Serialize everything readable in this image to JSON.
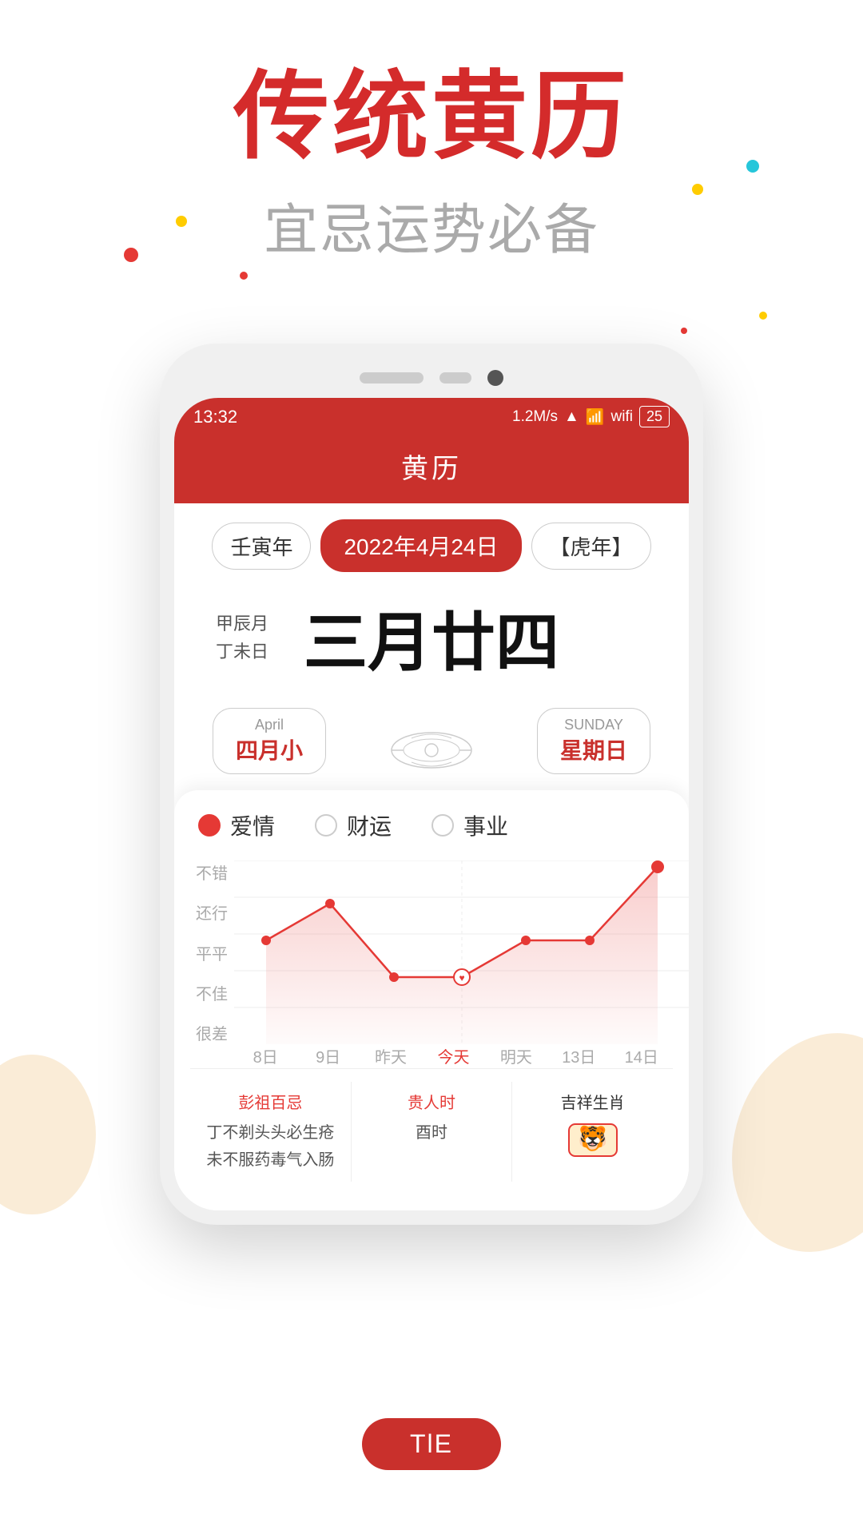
{
  "hero": {
    "title": "传统黄历",
    "subtitle": "宜忌运势必备"
  },
  "status_bar": {
    "time": "13:32",
    "speed": "1.2M/s",
    "battery": "25"
  },
  "app": {
    "title": "黄历"
  },
  "calendar": {
    "year_label": "壬寅年",
    "date_label": "2022年4月24日",
    "zodiac_label": "【虎年】",
    "month_label": "甲辰月",
    "day_label": "丁未日",
    "lunar_date": "三月廿四",
    "month_en": "April",
    "month_cn": "四月小",
    "weekday_en": "SUNDAY",
    "weekday_cn": "星期日"
  },
  "luck_chart": {
    "tabs": [
      {
        "label": "爱情",
        "active": true
      },
      {
        "label": "财运",
        "active": false
      },
      {
        "label": "事业",
        "active": false
      }
    ],
    "y_labels": [
      "不错",
      "还行",
      "平平",
      "不佳",
      "很差"
    ],
    "x_labels": [
      "8日",
      "9日",
      "昨天",
      "今天",
      "明天",
      "13日",
      "14日"
    ],
    "points": [
      {
        "x": 0,
        "y": 2
      },
      {
        "x": 1,
        "y": 1
      },
      {
        "x": 2,
        "y": 3
      },
      {
        "x": 3,
        "y": 3
      },
      {
        "x": 4,
        "y": 2
      },
      {
        "x": 5,
        "y": 2
      },
      {
        "x": 6,
        "y": 0
      }
    ],
    "today_index": 3
  },
  "bottom_info": {
    "col1": {
      "title": "彭祖百忌",
      "lines": [
        "丁不剃头头必生疮",
        "未不服药毒气入肠"
      ]
    },
    "col2": {
      "title": "贵人时",
      "value": "酉时"
    },
    "col3": {
      "title": "吉祥生肖"
    }
  },
  "bottom_badge": {
    "label": "TlE"
  }
}
